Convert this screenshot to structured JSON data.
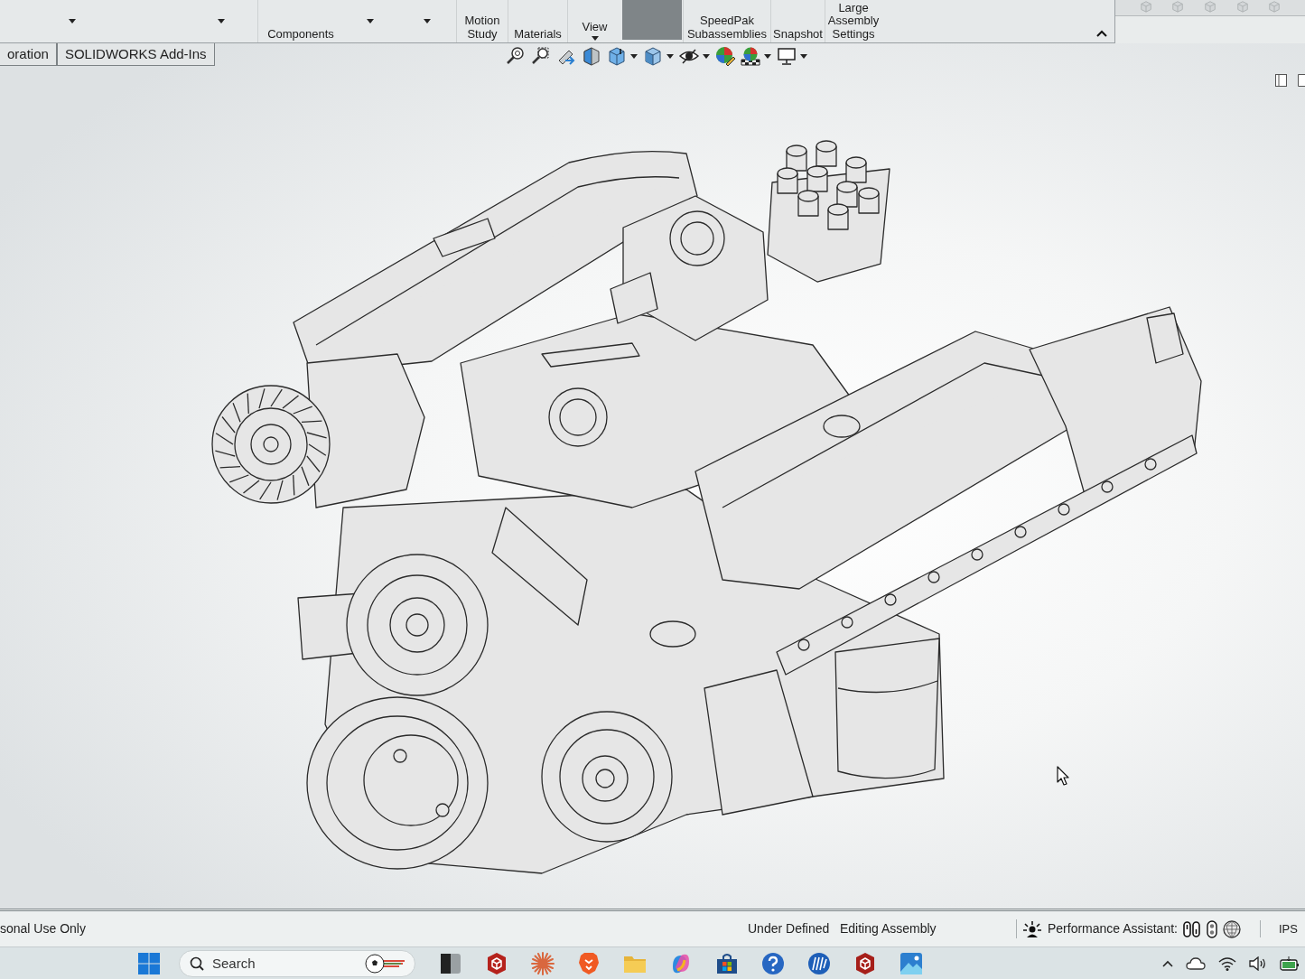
{
  "ribbon": {
    "items": [
      {
        "kind": "caret"
      },
      {
        "kind": "caret"
      },
      {
        "kind": "button",
        "label": "Components"
      },
      {
        "kind": "caret"
      },
      {
        "kind": "caret"
      },
      {
        "kind": "button",
        "label": "Motion Study"
      },
      {
        "kind": "button",
        "label": "Materials"
      },
      {
        "kind": "dropdown",
        "label": "View"
      },
      {
        "kind": "tile"
      },
      {
        "kind": "button",
        "label": "SpeedPak Subassemblies"
      },
      {
        "kind": "button",
        "label": "Snapshot"
      },
      {
        "kind": "button",
        "label": "Large Assembly Settings"
      }
    ]
  },
  "tabs": [
    {
      "label": "oration",
      "selected": false
    },
    {
      "label": "SOLIDWORKS Add-Ins",
      "selected": false
    }
  ],
  "status_bar": {
    "license": "sonal Use Only",
    "state": "Under Defined",
    "mode": "Editing Assembly",
    "assistant_label": "Performance Assistant:",
    "units": "IPS"
  },
  "taskbar": {
    "search": {
      "placeholder": "Search"
    }
  }
}
